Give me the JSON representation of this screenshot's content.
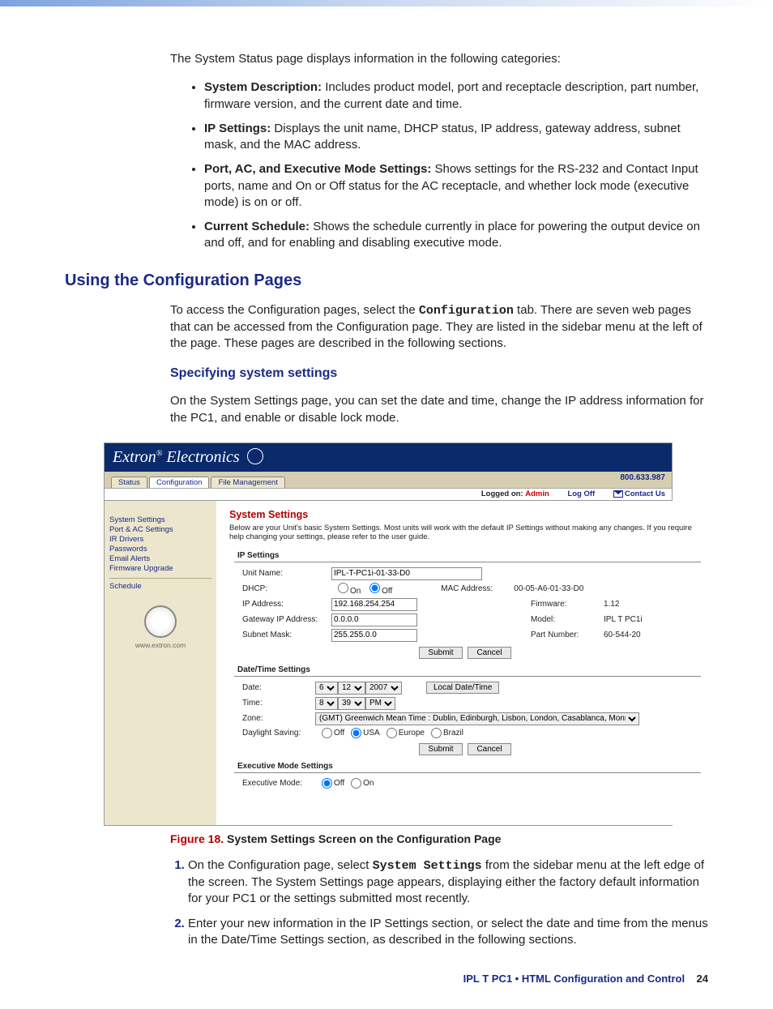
{
  "intro_text": "The System Status page displays information in the following categories:",
  "bullets": [
    {
      "label": "System Description:",
      "text": " Includes product model, port and receptacle description, part number, firmware version, and the current date and time."
    },
    {
      "label": "IP Settings:",
      "text": " Displays the unit name, DHCP status, IP address, gateway address, subnet mask, and the MAC address."
    },
    {
      "label": "Port, AC, and Executive Mode Settings:",
      "text": " Shows settings for the RS-232 and Contact Input ports, name and On or Off status for the AC receptacle, and whether lock mode (executive mode) is on or off."
    },
    {
      "label": "Current Schedule:",
      "text": " Shows the schedule currently in place for powering the output device on and off, and for enabling and disabling executive mode."
    }
  ],
  "heading1": "Using the Configuration Pages",
  "config_intro_pre": "To access the Configuration pages, select the ",
  "config_intro_mono": "Configuration",
  "config_intro_post": " tab. There are seven web pages that can be accessed from the Configuration page. They are listed in the sidebar menu at the left of the page. These pages are described in the following sections.",
  "heading2": "Specifying system settings",
  "sys_settings_para": "On the System Settings page, you can set the date and time, change the IP address information for the PC1, and enable or disable lock mode.",
  "screenshot": {
    "brand": "Extron",
    "brand2": "Electronics",
    "tabs": [
      "Status",
      "Configuration",
      "File Management"
    ],
    "active_tab": 1,
    "phone": "800.633.987",
    "logged_label": "Logged on:",
    "logged_user": "Admin",
    "logoff": "Log Off",
    "contact": "Contact Us",
    "sidebar": [
      "System Settings",
      "Port & AC Settings",
      "IR Drivers",
      "Passwords",
      "Email Alerts",
      "Firmware Upgrade"
    ],
    "sidebar_schedule": "Schedule",
    "site_link": "www.extron.com",
    "main_title": "System Settings",
    "main_desc": "Below are your Unit's basic System Settings. Most units will work with the default IP Settings without making any changes. If you require help changing your settings, please refer to the user guide.",
    "ip_section": "IP Settings",
    "ip": {
      "unit_label": "Unit Name:",
      "unit_value": "IPL-T-PC1i-01-33-D0",
      "dhcp_label": "DHCP:",
      "dhcp_on": "On",
      "dhcp_off": "Off",
      "mac_label": "MAC Address:",
      "mac_value": "00-05-A6-01-33-D0",
      "ip_label": "IP Address:",
      "ip_value": "192.168.254.254",
      "fw_label": "Firmware:",
      "fw_value": "1.12",
      "gw_label": "Gateway IP Address:",
      "gw_value": "0.0.0.0",
      "model_label": "Model:",
      "model_value": "IPL T PC1i",
      "mask_label": "Subnet Mask:",
      "mask_value": "255.255.0.0",
      "part_label": "Part Number:",
      "part_value": "60-544-20"
    },
    "submit": "Submit",
    "cancel": "Cancel",
    "dt_section": "Date/Time Settings",
    "dt": {
      "date_label": "Date:",
      "date_month": "6",
      "date_day": "12",
      "date_year": "2007",
      "local_btn": "Local Date/Time",
      "time_label": "Time:",
      "time_hr": "8",
      "time_min": "39",
      "time_ampm": "PM",
      "zone_label": "Zone:",
      "zone_value": "(GMT) Greenwich Mean Time : Dublin, Edinburgh, Lisbon, London, Casablanca, Monrovia",
      "ds_label": "Daylight Saving:",
      "ds_off": "Off",
      "ds_usa": "USA",
      "ds_eu": "Europe",
      "ds_br": "Brazil"
    },
    "exec_section": "Executive Mode Settings",
    "exec": {
      "label": "Executive Mode:",
      "off": "Off",
      "on": "On"
    }
  },
  "figure": {
    "num": "Figure 18.",
    "text": "System Settings Screen on the Configuration Page"
  },
  "step1_pre": "On the Configuration page, select ",
  "step1_mono": "System Settings",
  "step1_post": " from the sidebar menu at the left edge of the screen. The System Settings page appears, displaying either the factory default information for your PC1 or the settings submitted most recently.",
  "step2": "Enter your new information in the IP Settings section, or select the date and time from the menus in the Date/Time Settings section, as described in the following sections.",
  "footer": {
    "doc": "IPL T PC1 • HTML Configuration and Control",
    "page": "24"
  }
}
